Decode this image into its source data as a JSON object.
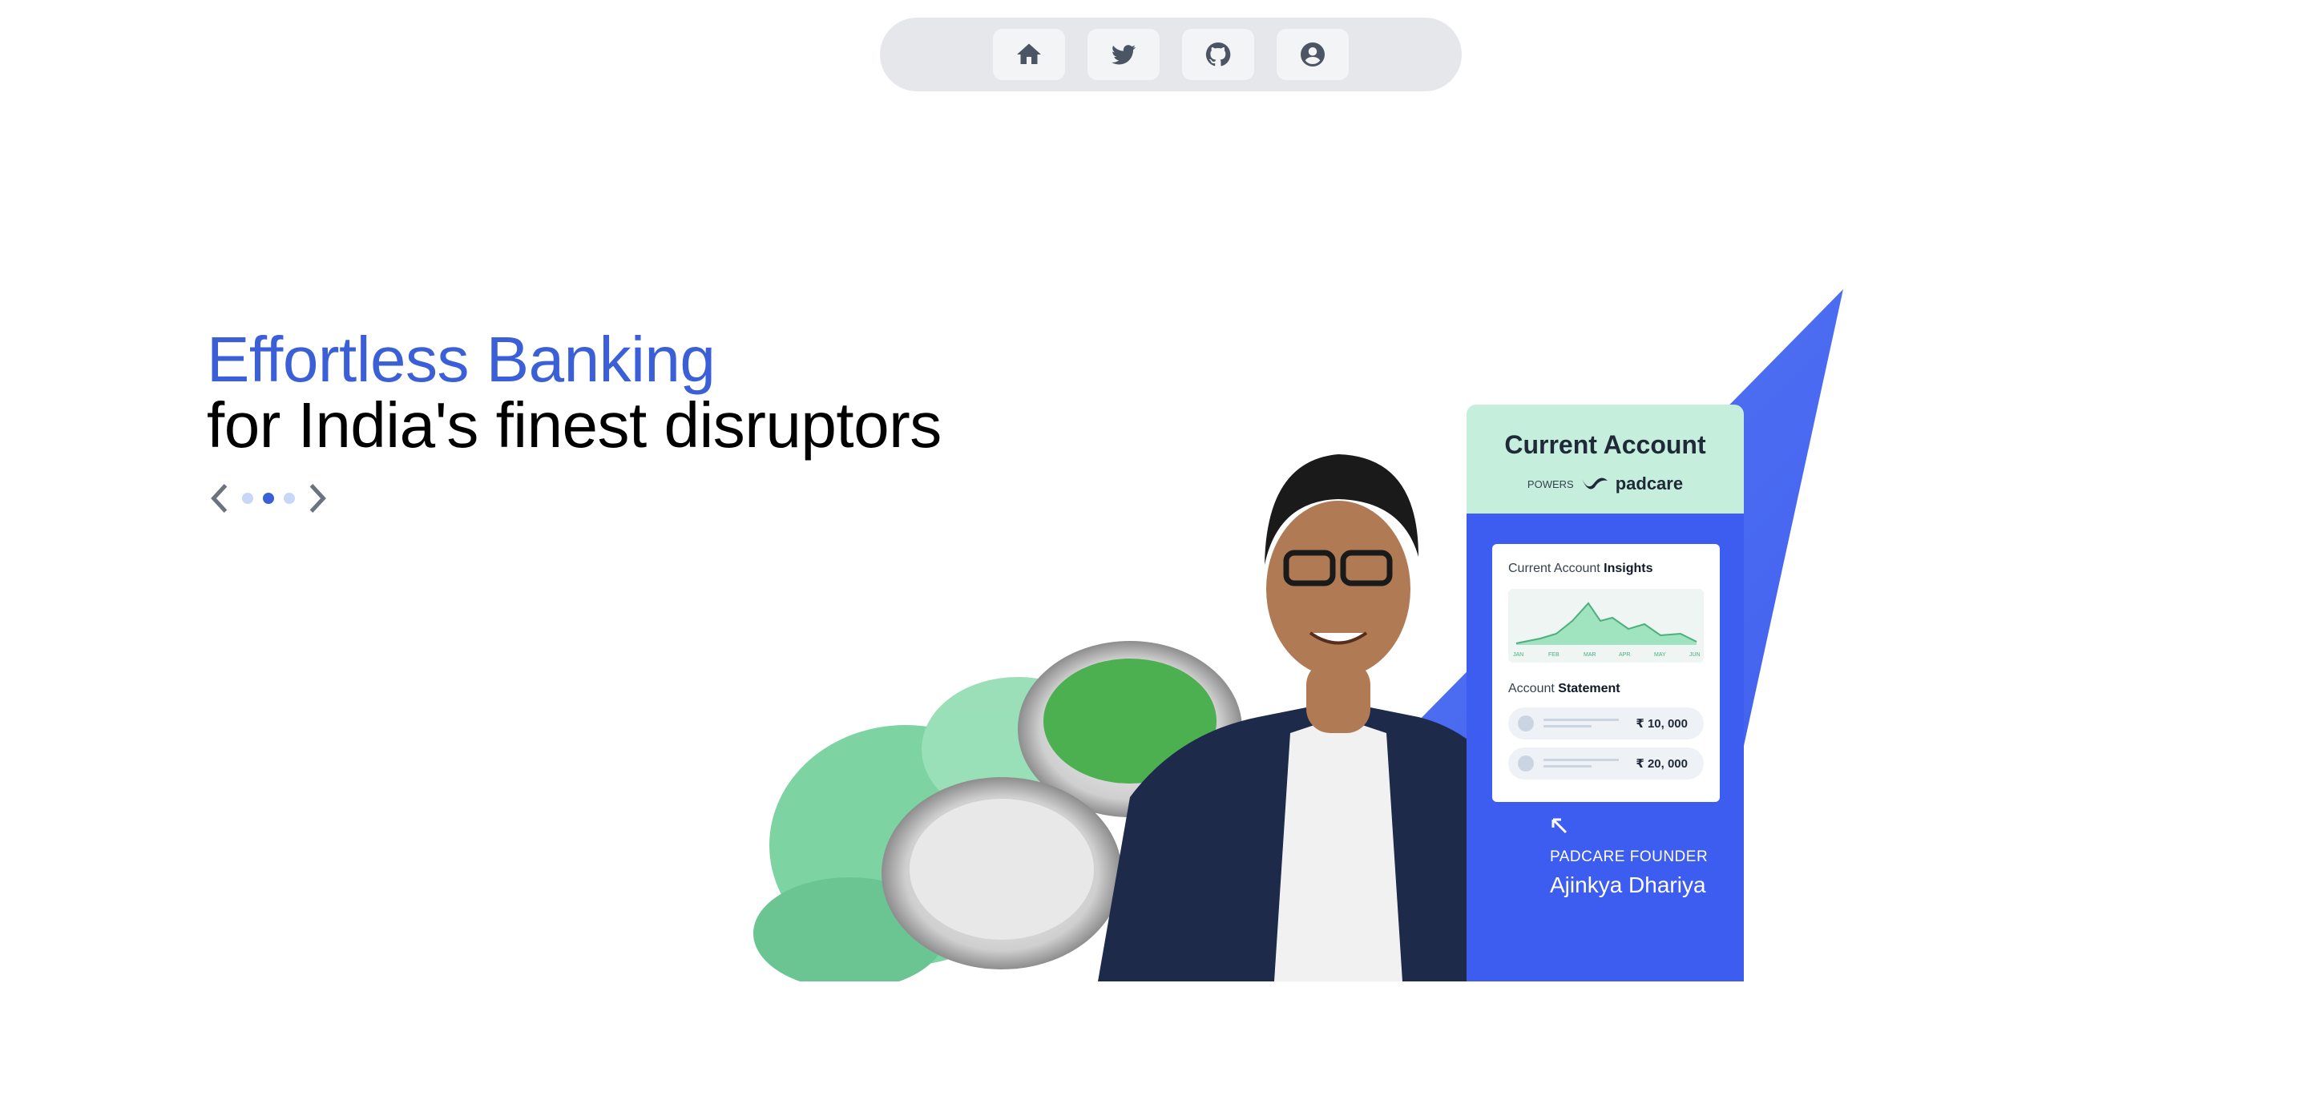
{
  "nav": {
    "items": [
      {
        "icon": "home-icon",
        "label": "Home"
      },
      {
        "icon": "twitter-icon",
        "label": "Twitter"
      },
      {
        "icon": "github-icon",
        "label": "GitHub"
      },
      {
        "icon": "user-icon",
        "label": "Profile"
      }
    ]
  },
  "hero": {
    "headline_accent": "Effortless Banking",
    "headline_rest": "for India's finest disruptors",
    "accent_color": "#3b5fd6"
  },
  "carousel": {
    "slide_count": 3,
    "active_index": 1
  },
  "card": {
    "title": "Current Account",
    "powers": "POWERS",
    "brand": "padcare",
    "insights_prefix": "Current Account ",
    "insights_bold": "Insights",
    "chart_months": [
      "JAN",
      "FEB",
      "MAR",
      "APR",
      "MAY",
      "JUN"
    ],
    "statement_prefix": "Account ",
    "statement_bold": "Statement",
    "rows": [
      {
        "amount": "₹ 10, 000"
      },
      {
        "amount": "₹ 20, 000"
      }
    ],
    "founder_role": "PADCARE FOUNDER",
    "founder_name": "Ajinkya Dhariya"
  },
  "colors": {
    "card_green": "#c5efdc",
    "card_blue": "#3d5cf0",
    "triangle_blue": "#4b6ff0"
  }
}
